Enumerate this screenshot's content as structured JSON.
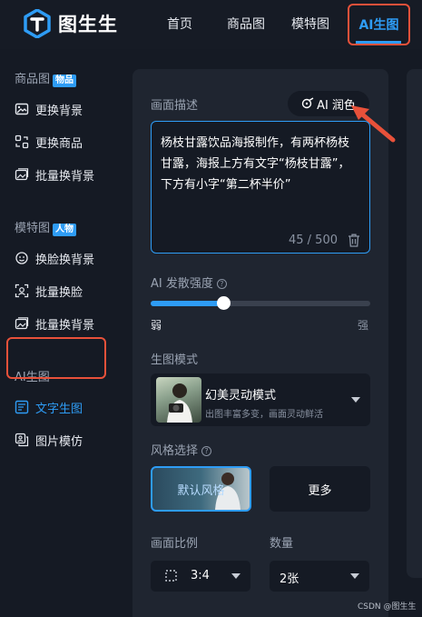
{
  "brand": {
    "name": "图生生"
  },
  "nav": {
    "items": [
      {
        "label": "首页"
      },
      {
        "label": "商品图"
      },
      {
        "label": "模特图"
      },
      {
        "label": "AI生图"
      }
    ]
  },
  "sidebar": {
    "sections": [
      {
        "title": "商品图",
        "tag": "物品",
        "items": [
          {
            "label": "更换背景",
            "icon": "image-edit-icon"
          },
          {
            "label": "更换商品",
            "icon": "swap-icon"
          },
          {
            "label": "批量换背景",
            "icon": "image-batch-icon"
          }
        ]
      },
      {
        "title": "模特图",
        "tag": "人物",
        "items": [
          {
            "label": "换脸换背景",
            "icon": "face-swap-icon"
          },
          {
            "label": "批量换脸",
            "icon": "face-scan-icon"
          },
          {
            "label": "批量换背景",
            "icon": "image-batch-icon"
          }
        ]
      },
      {
        "title": "AI生图",
        "tag": "",
        "items": [
          {
            "label": "文字生图",
            "icon": "text-image-icon"
          },
          {
            "label": "图片模仿",
            "icon": "image-copy-icon"
          }
        ]
      }
    ]
  },
  "editor": {
    "description_label": "画面描述",
    "ai_polish_label": "AI 润色",
    "prompt": "杨枝甘露饮品海报制作，有两杯杨枝甘露，海报上方有文字“杨枝甘露”，下方有小字“第二杯半价”",
    "char_count": "45 / 500",
    "divergence_label": "AI 发散强度",
    "divergence_value": 0.33,
    "divergence_min": "弱",
    "divergence_max": "强",
    "mode_label": "生图模式",
    "mode_title": "幻美灵动模式",
    "mode_desc": "出图丰富多变，画面灵动鲜活",
    "style_label": "风格选择",
    "style_default": "默认风格",
    "style_more": "更多",
    "ratio_label": "画面比例",
    "ratio_value": "3:4",
    "quantity_label": "数量",
    "quantity_value": "2张"
  },
  "watermark": "CSDN @图生生",
  "colors": {
    "accent": "#2e9cf5",
    "highlight": "#e8513a"
  }
}
